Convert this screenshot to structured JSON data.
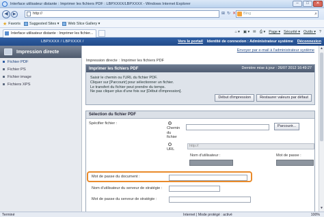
{
  "window": {
    "title": "Interface utilisateur distante : Imprimer les fichiers PDF : LBPXXXX/LBPXXXX - Windows Internet Explorer",
    "controls": [
      "–",
      "□",
      "✕"
    ]
  },
  "addressbar": {
    "url": "http://",
    "search_engine": "Bing",
    "back_icon": "back-arrow-icon",
    "forward_icon": "forward-arrow-icon"
  },
  "favorites": {
    "label": "Favoris",
    "items": [
      "Suggested Sites ▾",
      "Web Slice Gallery ▾"
    ]
  },
  "tab": {
    "label": "Interface utilisateur distante : Imprimer les fichier..."
  },
  "commands": {
    "page": "Page ▾",
    "security": "Sécurité ▾",
    "tools": "Outils ▾",
    "help": "?"
  },
  "header": {
    "printer": "LBPXXXX / LBPXXXX /",
    "portal": "Vers le portail",
    "login": "Identité de connexion : Administrateur système",
    "logout": "Déconnexion"
  },
  "nav": {
    "title": "Impression directe",
    "items": [
      "Fichier PDF",
      "Fichier PS",
      "Fichier image",
      "Fichiers XPS"
    ]
  },
  "main": {
    "mail_link": "Envoyer par e-mail à l'administrateur système",
    "breadcrumb_root": "Impression directe",
    "breadcrumb_current": "Imprimer les fichiers PDF",
    "page_title": "Imprimer les fichiers PDF",
    "last_update": "Dernière mise à jour : 26/07 2012 16:49:27",
    "instructions": [
      "Saisir le chemin ou l'URL du fichier PDF.",
      "Cliquer sur [Parcourir] pour sélectionner un fichier.",
      "Le transfert du fichier peut prendre du temps.",
      "Ne pas cliquer plus d'une fois sur [Début d'impression]."
    ],
    "start_button": "Début d'impression",
    "restore_button": "Restaurer valeurs par défaut"
  },
  "section": {
    "title": "Sélection du fichier PDF",
    "specify_label": "Spécifier fichier :",
    "radio_path": "Chemin du fichier",
    "radio_url": "URL",
    "browse_button": "Parcourir...",
    "url_value": "http://",
    "username_label": "Nom d'utilisateur :",
    "password_label": "Mot de passe :",
    "doc_password_label": "Mot de passe du document :",
    "policy_user_label": "Nom d'utilisateur du serveur de stratégie :",
    "policy_pass_label": "Mot de passe du serveur de stratégie :"
  },
  "status": {
    "left": "Terminé",
    "zone": "Internet | Mode protégé : activé",
    "zoom": "100%"
  }
}
